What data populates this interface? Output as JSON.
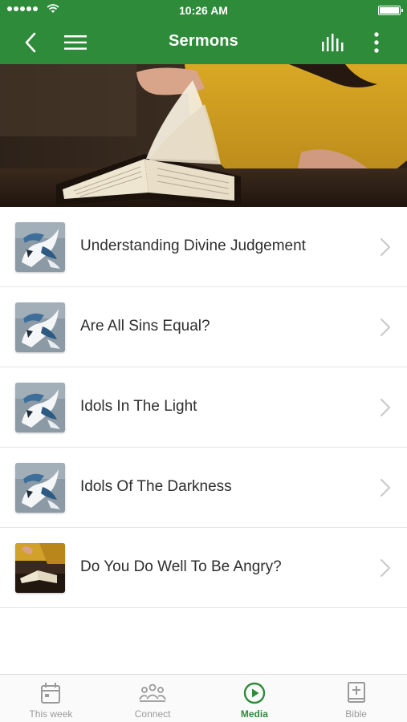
{
  "status_bar": {
    "time": "10:26 AM",
    "signal_icon": "signal-dots-icon",
    "wifi_icon": "wifi-icon",
    "battery_icon": "battery-icon"
  },
  "nav": {
    "title": "Sermons",
    "back_icon": "chevron-left-icon",
    "menu_icon": "hamburger-menu-icon",
    "audio_icon": "audio-bars-icon",
    "more_icon": "more-vertical-icon",
    "color": "#2e8b3a"
  },
  "hero": {
    "description_icon": "open-bible-photo"
  },
  "sermons": [
    {
      "title": "Understanding Divine Judgement",
      "thumb": "dove-artwork"
    },
    {
      "title": "Are All Sins Equal?",
      "thumb": "dove-artwork"
    },
    {
      "title": "Idols In The Light",
      "thumb": "dove-artwork"
    },
    {
      "title": "Idols Of The Darkness",
      "thumb": "dove-artwork"
    },
    {
      "title": "Do You Do Well To Be Angry?",
      "thumb": "bible-reading-photo"
    }
  ],
  "tabs": [
    {
      "label": "This week",
      "icon": "calendar-icon",
      "active": false
    },
    {
      "label": "Connect",
      "icon": "people-icon",
      "active": false
    },
    {
      "label": "Media",
      "icon": "play-circle-icon",
      "active": true
    },
    {
      "label": "Bible",
      "icon": "bible-plus-icon",
      "active": false
    }
  ],
  "colors": {
    "brand_green": "#2e8b3a",
    "inactive_tab": "#9a9a9a",
    "divider": "#e6e6e6"
  }
}
